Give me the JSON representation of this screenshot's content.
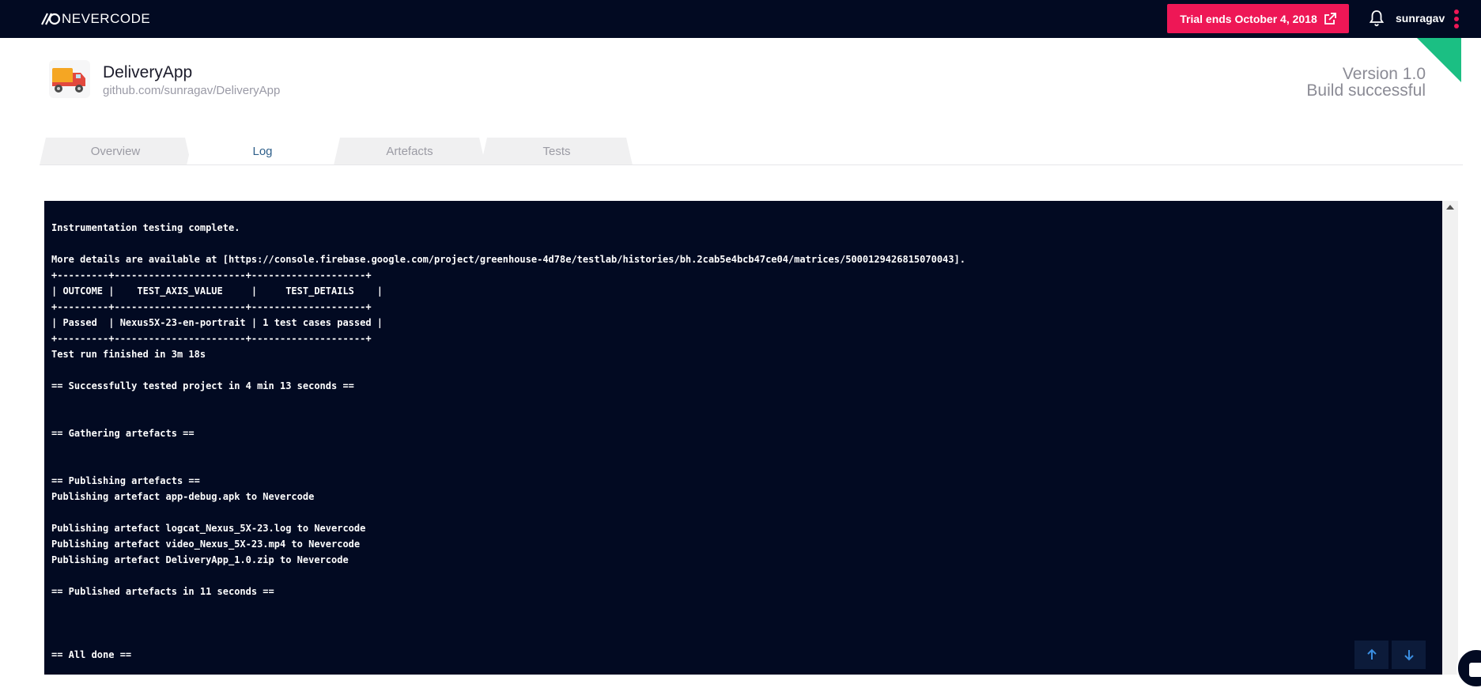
{
  "topbar": {
    "brand": "NEVERCODE",
    "trial_label": "Trial ends October 4, 2018",
    "username": "sunragav",
    "icons": [
      "nevercode-logo-icon",
      "external-link-icon",
      "bell-icon",
      "kebab-menu-icon"
    ],
    "accent_color": "#ee1756",
    "bar_color": "#020a22"
  },
  "project": {
    "name": "DeliveryApp",
    "repo": "github.com/sunragav/DeliveryApp",
    "version": "Version 1.0",
    "status": "Build successful",
    "status_color": "#1bbf83"
  },
  "tabs": [
    {
      "label": "Overview",
      "active": false
    },
    {
      "label": "Log",
      "active": true
    },
    {
      "label": "Artefacts",
      "active": false
    },
    {
      "label": "Tests",
      "active": false
    }
  ],
  "log": {
    "lines": [
      "Instrumentation testing complete.",
      "",
      "More details are available at [https://console.firebase.google.com/project/greenhouse-4d78e/testlab/histories/bh.2cab5e4bcb47ce04/matrices/5000129426815070043].",
      "+---------+-----------------------+--------------------+",
      "| OUTCOME |    TEST_AXIS_VALUE     |     TEST_DETAILS    |",
      "+---------+-----------------------+--------------------+",
      "| Passed  | Nexus5X-23-en-portrait | 1 test cases passed |",
      "+---------+-----------------------+--------------------+",
      "Test run finished in 3m 18s",
      "",
      "== Successfully tested project in 4 min 13 seconds ==",
      "",
      "",
      "== Gathering artefacts ==",
      "",
      "",
      "== Publishing artefacts ==",
      "Publishing artefact app-debug.apk to Nevercode",
      "",
      "Publishing artefact logcat_Nexus_5X-23.log to Nevercode",
      "Publishing artefact video_Nexus_5X-23.mp4 to Nevercode",
      "Publishing artefact DeliveryApp_1.0.zip to Nevercode",
      "",
      "== Published artefacts in 11 seconds ==",
      "",
      "",
      "",
      "== All done =="
    ]
  },
  "controls": {
    "scroll_up_icon": "arrow-up-icon",
    "scroll_down_icon": "arrow-down-icon"
  }
}
